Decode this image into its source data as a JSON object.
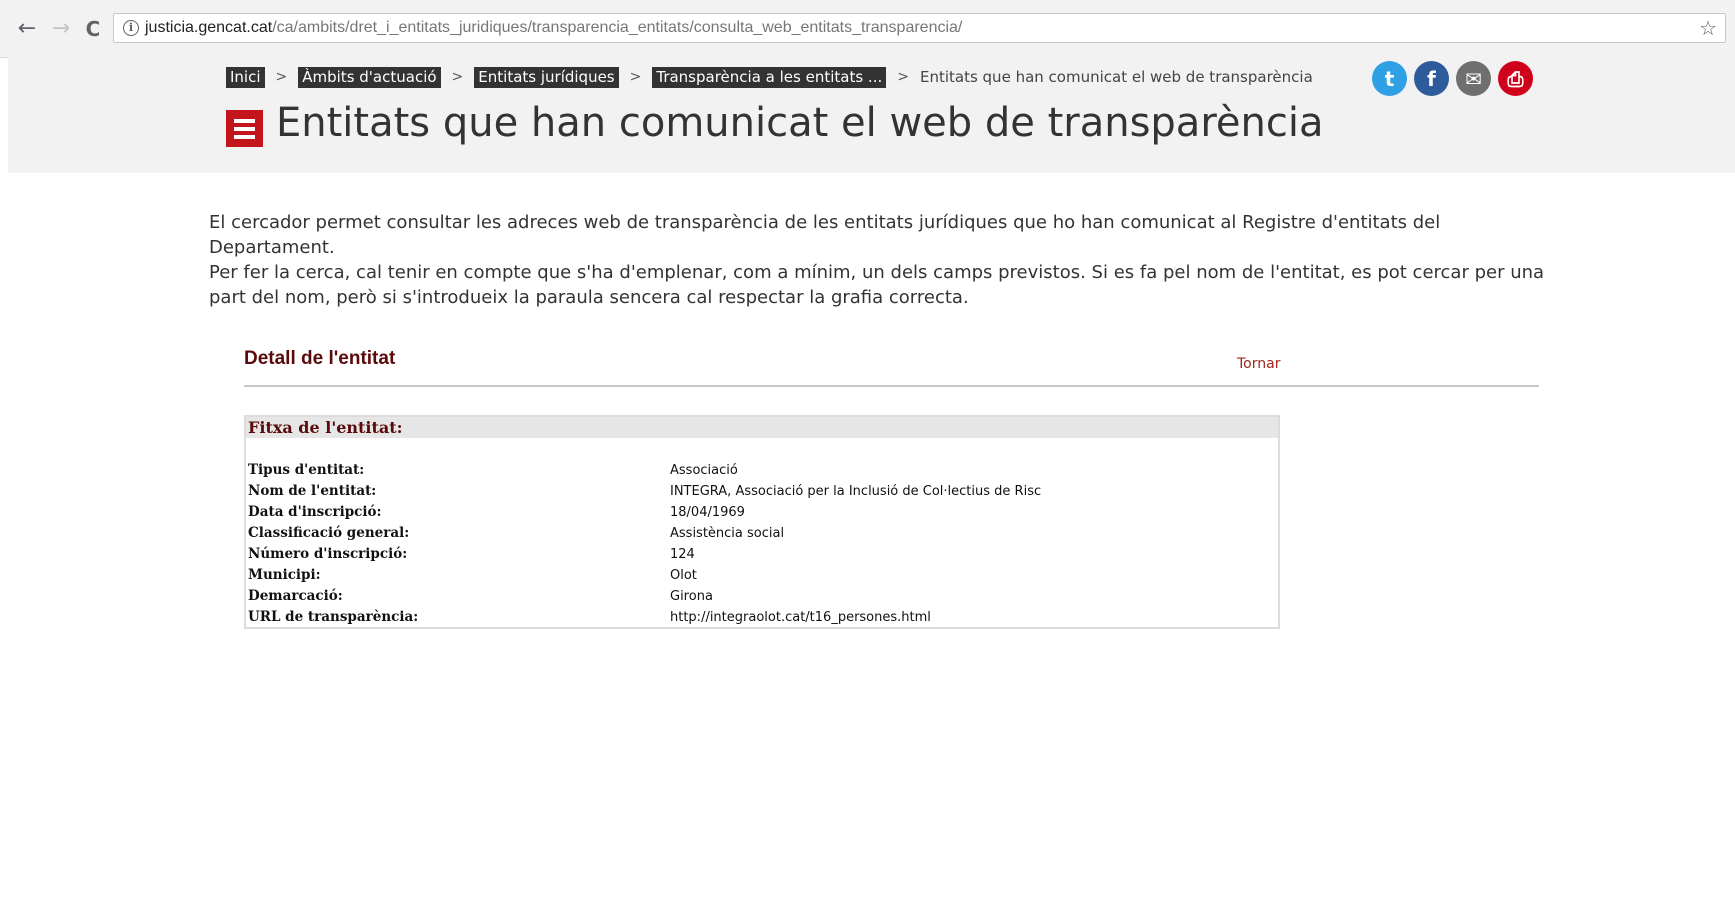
{
  "browser": {
    "back_icon": "←",
    "forward_icon": "→",
    "reload_icon": "C",
    "url_host": "justicia.gencat.cat",
    "url_path": "/ca/ambits/dret_i_entitats_juridiques/transparencia_entitats/consulta_web_entitats_transparencia/",
    "info_icon": "i",
    "bookmark_icon": "☆"
  },
  "breadcrumb": {
    "items": [
      "Inici",
      "Àmbits d'actuació",
      "Entitats jurídiques",
      "Transparència a les entitats ..."
    ],
    "separator": ">",
    "current": "Entitats que han comunicat el web de transparència"
  },
  "share": {
    "twitter": "t",
    "facebook": "f",
    "email": "✉",
    "print": "⎙"
  },
  "page": {
    "title": "Entitats que han comunicat el web de transparència",
    "intro_1": "El cercador permet consultar les adreces web de transparència de les entitats jurídiques que ho han comunicat al Registre d'entitats del Departament.",
    "intro_2": "Per fer la cerca, cal tenir en compte que s'ha d'emplenar, com a mínim, un dels camps previstos. Si es fa pel nom de l'entitat, es pot cercar per una part del nom, però si s'introdueix la paraula sencera cal respectar la grafia correcta."
  },
  "detail": {
    "title": "Detall de l'entitat",
    "back_label": "Tornar",
    "card_title": "Fitxa de l'entitat:",
    "fields": [
      {
        "label": "Tipus d'entitat:",
        "value": "Associació"
      },
      {
        "label": "Nom de l'entitat:",
        "value": "INTEGRA, Associació per la Inclusió de Col·lectius de Risc"
      },
      {
        "label": "Data d'inscripció:",
        "value": "18/04/1969"
      },
      {
        "label": "Classificació general:",
        "value": "Assistència social"
      },
      {
        "label": "Número d'inscripció:",
        "value": "124"
      },
      {
        "label": "Municipi:",
        "value": "Olot"
      },
      {
        "label": "Demarcació:",
        "value": "Girona"
      },
      {
        "label": "URL de transparència:",
        "value": "http://integraolot.cat/t16_persones.html"
      }
    ]
  },
  "colors": {
    "accent_red": "#c4151c",
    "dark_red_text": "#5a0a0a",
    "crumb_bg": "#333333",
    "header_bg": "#f2f2f2"
  }
}
